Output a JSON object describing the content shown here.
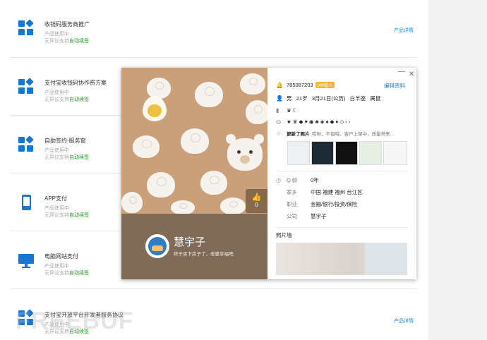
{
  "list": {
    "items": [
      {
        "title": "收钱码服务商推广",
        "sub1": "产品使用中",
        "sub2_prefix": "无异议支持",
        "sub2_highlight": "自动续签",
        "detail": "产品详情",
        "icon": "grid-icon"
      },
      {
        "title": "支付宝收钱码协作费方案",
        "sub1": "产品使用中",
        "sub2_prefix": "无异议支持",
        "sub2_highlight": "自动续签",
        "detail": "",
        "icon": "grid-icon"
      },
      {
        "title": "自助签约-服务窗",
        "sub1": "产品使用中",
        "sub2_prefix": "无异议支持",
        "sub2_highlight": "自动续签",
        "detail": "",
        "icon": "grid-icon"
      },
      {
        "title": "APP支付",
        "sub1": "产品使用中",
        "sub2_prefix": "无异议支持",
        "sub2_highlight": "自动续签",
        "detail": "",
        "icon": "phone-icon"
      },
      {
        "title": "电脑网站支付",
        "sub1": "产品使用中",
        "sub2_prefix": "无异议支持",
        "sub2_highlight": "自动续签",
        "detail": "",
        "icon": "monitor-icon"
      },
      {
        "title": "支付宝开放平台开发者服务协议",
        "sub1": "产品使用中",
        "sub2_prefix": "无异议支持",
        "sub2_highlight": "自动续签",
        "detail": "产品详情",
        "icon": "grid-icon"
      }
    ]
  },
  "popup": {
    "nickname": "慧宇子",
    "signature": "终于买下房子了，老婆享福吧",
    "like_count": "0",
    "qq_number": "785087203",
    "vip_badge": "VIP超人",
    "edit_label": "编辑资料",
    "gender": "男",
    "age": "21岁",
    "birthday": "3月21日(公历)",
    "zodiac": "白羊座",
    "animal": "属鼠",
    "level_icons": "♛ ☾",
    "badges_row": "★ ♛ ◆ ♥ ◉ ♣ ◈ ♠ ◆ ♦ ◇ ‹ ›",
    "photo_update_label": "更新了照片",
    "photo_update_text": "哎哟，不错哦，客户上架中，质量带来...",
    "qage_label": "Q 龄",
    "qage_value": "0年",
    "hometown_label": "家乡",
    "hometown_value": "中国 福建 福州 台江区",
    "job_label": "职业",
    "job_value": "金融/银行/投资/保险",
    "company_label": "公司",
    "company_value": "慧宇子",
    "photo_wall_label": "照片墙"
  },
  "watermark": "FREEBUF",
  "colors": {
    "accent": "#1677d2",
    "green": "#1aa31a",
    "cover": "#c9a07a",
    "band": "#806b58"
  }
}
